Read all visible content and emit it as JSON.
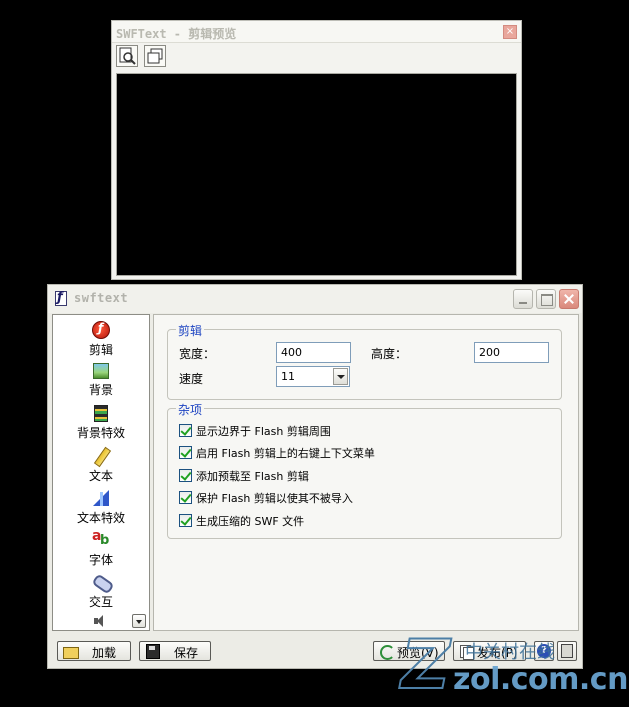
{
  "preview_window": {
    "title": "SWFText - 剪辑预览",
    "close_glyph": "×",
    "toolbar": [
      {
        "name": "zoom-preview-icon"
      },
      {
        "name": "fit-window-icon"
      }
    ]
  },
  "main_window": {
    "title": "swftext",
    "sidebar": {
      "items": [
        {
          "label": "剪辑",
          "icon": "flash-clip-icon"
        },
        {
          "label": "背景",
          "icon": "background-image-icon"
        },
        {
          "label": "背景特效",
          "icon": "film-strip-icon"
        },
        {
          "label": "文本",
          "icon": "pencil-icon"
        },
        {
          "label": "文本特效",
          "icon": "text-effect-icon"
        },
        {
          "label": "字体",
          "icon": "font-icon"
        },
        {
          "label": "交互",
          "icon": "link-icon"
        }
      ],
      "partial_item_icon": "speaker-icon"
    },
    "clip_group": {
      "legend": "剪辑",
      "width_label": "宽度：",
      "width_value": "400",
      "height_label": "高度：",
      "height_value": "200",
      "speed_label": "速度",
      "speed_value": "11"
    },
    "misc_group": {
      "legend": "杂项",
      "options": [
        {
          "label": "显示边界于 Flash 剪辑周围",
          "checked": true
        },
        {
          "label": "启用 Flash 剪辑上的右键上下文菜单",
          "checked": true
        },
        {
          "label": "添加预载至 Flash 剪辑",
          "checked": true
        },
        {
          "label": "保护 Flash 剪辑以使其不被导入",
          "checked": true
        },
        {
          "label": "生成压缩的 SWF 文件",
          "checked": true
        }
      ]
    },
    "buttons": {
      "load": "加载",
      "save": "保存",
      "preview": "预览(V)",
      "publish": "发布(P)",
      "help": "?"
    }
  },
  "watermark": {
    "tagline": "中关村在线",
    "domain": "zol.com.cn"
  },
  "colors": {
    "legend_blue": "#1d44c2",
    "check_green": "#21a121",
    "preview_canvas": "#000000"
  }
}
